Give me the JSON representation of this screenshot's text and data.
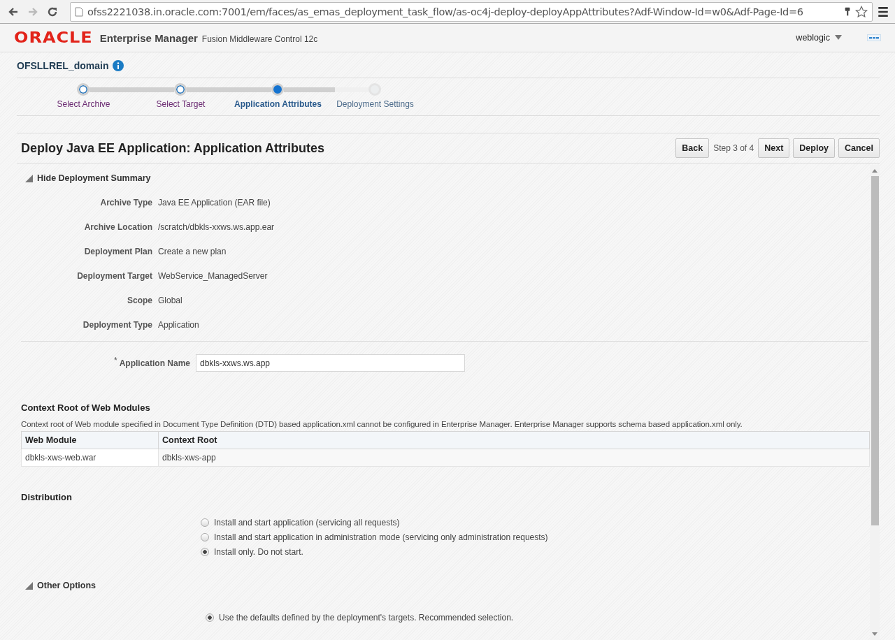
{
  "browser": {
    "url": "ofss2221038.in.oracle.com:7001/em/faces/as_emas_deployment_task_flow/as-oc4j-deploy-deployAppAttributes?Adf-Window-Id=w0&Adf-Page-Id=6"
  },
  "header": {
    "logo": "ORACLE",
    "product": "Enterprise Manager",
    "subtitle": "Fusion Middleware Control 12c",
    "user": "weblogic"
  },
  "domain": {
    "name": "OFSLLREL_domain"
  },
  "train": [
    {
      "label": "Select Archive",
      "visited": true,
      "selected": false
    },
    {
      "label": "Select Target",
      "visited": true,
      "selected": false
    },
    {
      "label": "Application Attributes",
      "visited": true,
      "selected": true
    },
    {
      "label": "Deployment Settings",
      "visited": false,
      "selected": false
    }
  ],
  "page_title": "Deploy Java EE Application: Application Attributes",
  "toolbar": {
    "back": "Back",
    "step": "Step 3 of 4",
    "next": "Next",
    "deploy": "Deploy",
    "cancel": "Cancel"
  },
  "summary": {
    "toggle": "Hide Deployment Summary",
    "expanded": true,
    "rows": [
      {
        "label": "Archive Type",
        "value": "Java EE Application (EAR file)"
      },
      {
        "label": "Archive Location",
        "value": "/scratch/dbkls-xxws.ws.app.ear"
      },
      {
        "label": "Deployment Plan",
        "value": "Create a new plan"
      },
      {
        "label": "Deployment Target",
        "value": "WebService_ManagedServer"
      },
      {
        "label": "Scope",
        "value": "Global"
      },
      {
        "label": "Deployment Type",
        "value": "Application"
      }
    ]
  },
  "application_name": {
    "required_mark": "*",
    "label": "Application Name",
    "value": "dbkls-xxws.ws.app"
  },
  "context_root": {
    "heading": "Context Root of Web Modules",
    "note": "Context root of Web module specified in Document Type Definition (DTD) based application.xml cannot be configured in Enterprise Manager. Enterprise Manager supports schema based application.xml only.",
    "columns": [
      "Web Module",
      "Context Root"
    ],
    "rows": [
      [
        "dbkls-xws-web.war",
        "dbkls-xws-app"
      ]
    ]
  },
  "distribution": {
    "heading": "Distribution",
    "options": [
      {
        "label": "Install and start application (servicing all requests)",
        "selected": false
      },
      {
        "label": "Install and start application in administration mode (servicing only administration requests)",
        "selected": false
      },
      {
        "label": "Install only. Do not start.",
        "selected": true
      }
    ]
  },
  "other_options": {
    "toggle": "Other Options",
    "expanded": true,
    "options": [
      {
        "label": "Use the defaults defined by the deployment's targets. Recommended selection.",
        "selected": true
      }
    ]
  }
}
